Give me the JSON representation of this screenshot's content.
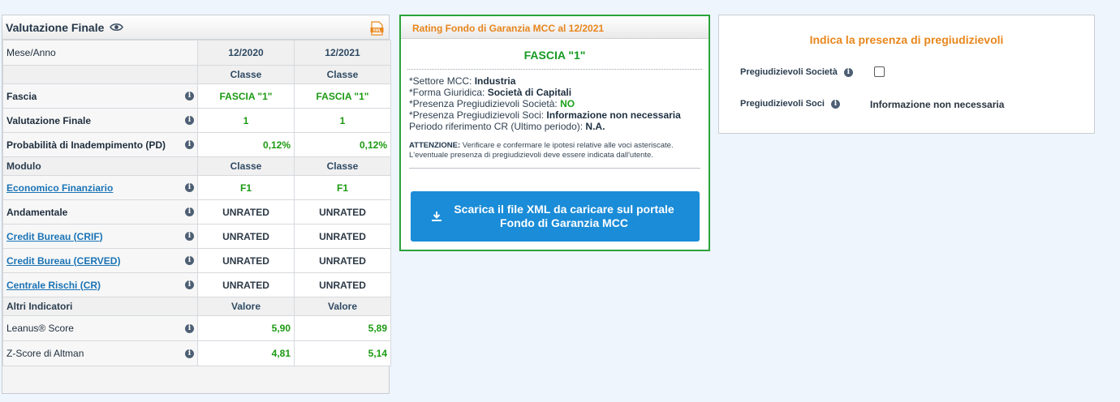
{
  "valutazione": {
    "title": "Valutazione Finale",
    "periods": [
      "12/2020",
      "12/2021"
    ],
    "header_label": "Mese/Anno",
    "classe_label": "Classe",
    "rows_top": [
      {
        "label": "Fascia",
        "values": [
          "FASCIA \"1\"",
          "FASCIA \"1\""
        ]
      },
      {
        "label": "Valutazione Finale",
        "values": [
          "1",
          "1"
        ]
      },
      {
        "label": "Probabilità di Inadempimento (PD)",
        "values": [
          "0,12%",
          "0,12%"
        ]
      }
    ],
    "modulo_label": "Modulo",
    "modulo_rows": [
      {
        "label": "Economico Finanziario",
        "values": [
          "F1",
          "F1"
        ]
      },
      {
        "label": "Andamentale",
        "values": [
          "UNRATED",
          "UNRATED"
        ]
      },
      {
        "label": "Credit Bureau (CRIF)",
        "values": [
          "UNRATED",
          "UNRATED"
        ]
      },
      {
        "label": "Credit Bureau (CERVED)",
        "values": [
          "UNRATED",
          "UNRATED"
        ]
      },
      {
        "label": "Centrale Rischi (CR)",
        "values": [
          "UNRATED",
          "UNRATED"
        ]
      }
    ],
    "altri_label": "Altri Indicatori",
    "valore_label": "Valore",
    "altri_rows": [
      {
        "label": "Leanus® Score",
        "values": [
          "5,90",
          "5,89"
        ]
      },
      {
        "label": "Z-Score di Altman",
        "values": [
          "4,81",
          "5,14"
        ]
      }
    ],
    "xml_icon_text": "XML"
  },
  "rating": {
    "title": "Rating Fondo di Garanzia MCC al 12/2021",
    "fascia": "FASCIA \"1\"",
    "lines": [
      {
        "label": "*Settore MCC: ",
        "value": "Industria"
      },
      {
        "label": "*Forma Giuridica: ",
        "value": "Società di Capitali"
      },
      {
        "label": "*Presenza Pregiudizievoli Società: ",
        "value": "NO"
      },
      {
        "label": "*Presenza Pregiudizievoli Soci: ",
        "value": "Informazione non necessaria"
      },
      {
        "label": "Periodo riferimento CR (Ultimo periodo): ",
        "value": "N.A."
      }
    ],
    "attention_label": "ATTENZIONE:",
    "attention_text": " Verificare e confermare le ipotesi relative alle voci asteriscate. L'eventuale presenza di pregiudizievoli deve essere indicata dall'utente.",
    "button_line1": "Scarica il file XML da caricare sul portale",
    "button_line2": "Fondo di Garanzia MCC"
  },
  "pregiudizievoli": {
    "title": "Indica la presenza di pregiudizievoli",
    "societa_label": "Pregiudizievoli Società",
    "soci_label": "Pregiudizievoli Soci",
    "soci_value": "Informazione non necessaria"
  },
  "colors": {
    "accent_orange": "#e8861c",
    "green": "#1c9a12",
    "button_blue": "#1a8cd8",
    "border_green": "#2aa33a"
  }
}
